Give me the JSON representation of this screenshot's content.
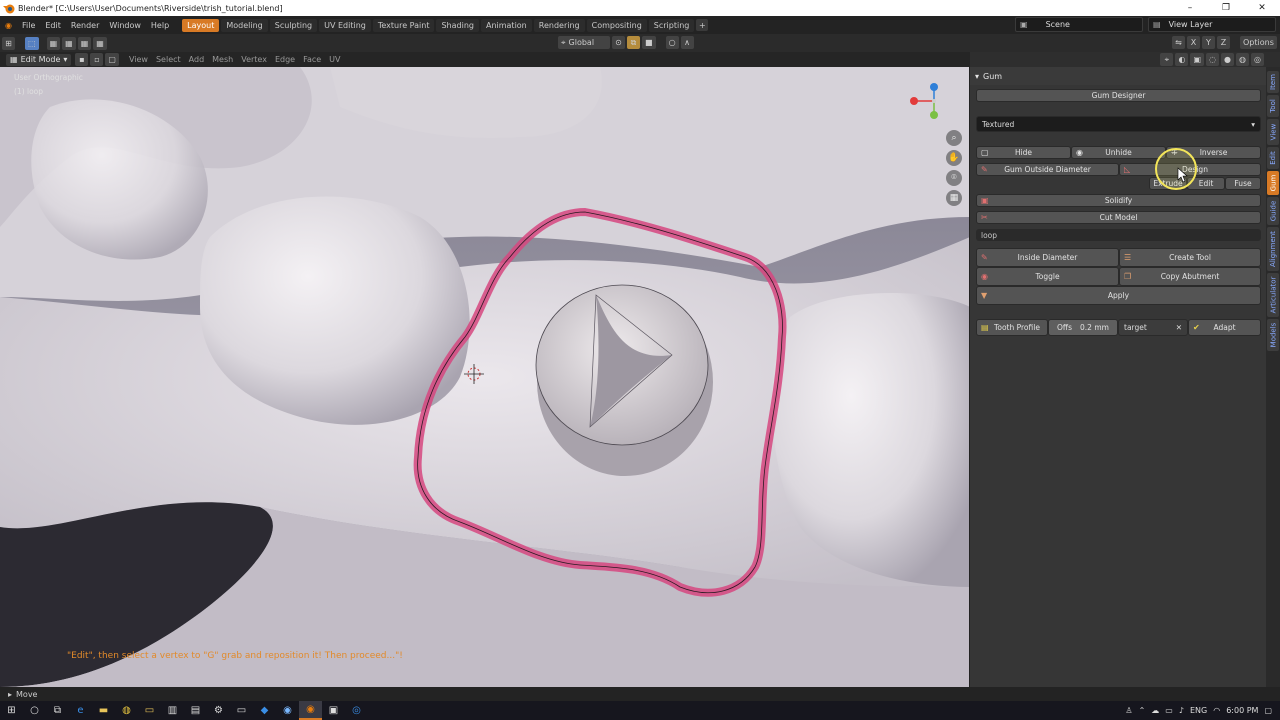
{
  "window": {
    "title": "Blender* [C:\\Users\\User\\Documents\\Riverside\\trish_tutorial.blend]",
    "controls": [
      "–",
      "❐",
      "✕"
    ]
  },
  "menubar": {
    "items": [
      "File",
      "Edit",
      "Render",
      "Window",
      "Help"
    ],
    "workspaces": [
      "Layout",
      "Modeling",
      "Sculpting",
      "UV Editing",
      "Texture Paint",
      "Shading",
      "Animation",
      "Rendering",
      "Compositing",
      "Scripting"
    ],
    "active_workspace": "Layout",
    "add_symbol": "+",
    "scene": "Scene",
    "view_layer": "View Layer"
  },
  "toolbar": {
    "orientation": "Global",
    "options": "Options",
    "axes": [
      "X",
      "Y",
      "Z"
    ]
  },
  "viewport_header": {
    "mode": "Edit Mode",
    "menus": [
      "View",
      "Select",
      "Add",
      "Mesh",
      "Vertex",
      "Edge",
      "Face",
      "UV"
    ]
  },
  "viewport": {
    "view_name": "User Orthographic",
    "object_name": "(1) loop",
    "hint": "\"Edit\", then select a vertex to \"G\" grab and reposition it! Then proceed...\"!",
    "gizmo_colors": {
      "x": "#e23b3b",
      "y": "#7bc043",
      "z": "#2f7fd8"
    }
  },
  "gum_panel": {
    "header": "Gum",
    "gum_designer": "Gum Designer",
    "shading_mode": "Textured",
    "hide": "Hide",
    "unhide": "Unhide",
    "inverse": "Inverse",
    "gum_outside_diameter": "Gum Outside Diameter",
    "design": "Design",
    "extrude": "Extrude",
    "edit": "Edit",
    "fuse": "Fuse",
    "solidify": "Solidify",
    "cut_model": "Cut Model",
    "object_field": "loop",
    "inside_diameter": "Inside Diameter",
    "create_tool": "Create Tool",
    "toggle": "Toggle",
    "copy_abutment": "Copy Abutment",
    "apply": "Apply",
    "tooth_profile": "Tooth Profile",
    "offset_label": "Offs",
    "offset_value": "0.2 mm",
    "target_field": "target",
    "adapt": "Adapt"
  },
  "side_tabs": [
    "Item",
    "Tool",
    "View",
    "Edit",
    "Gum",
    "Guide",
    "Alignment",
    "Articulator",
    "Models"
  ],
  "active_side_tab": "Gum",
  "statusbar": {
    "action": "Move"
  },
  "tray": {
    "language": "ENG",
    "time": "6:00 PM"
  },
  "colors": {
    "accent": "#d87a25",
    "loop_curve": "#d6477f",
    "hint_text": "#e28a2a"
  }
}
